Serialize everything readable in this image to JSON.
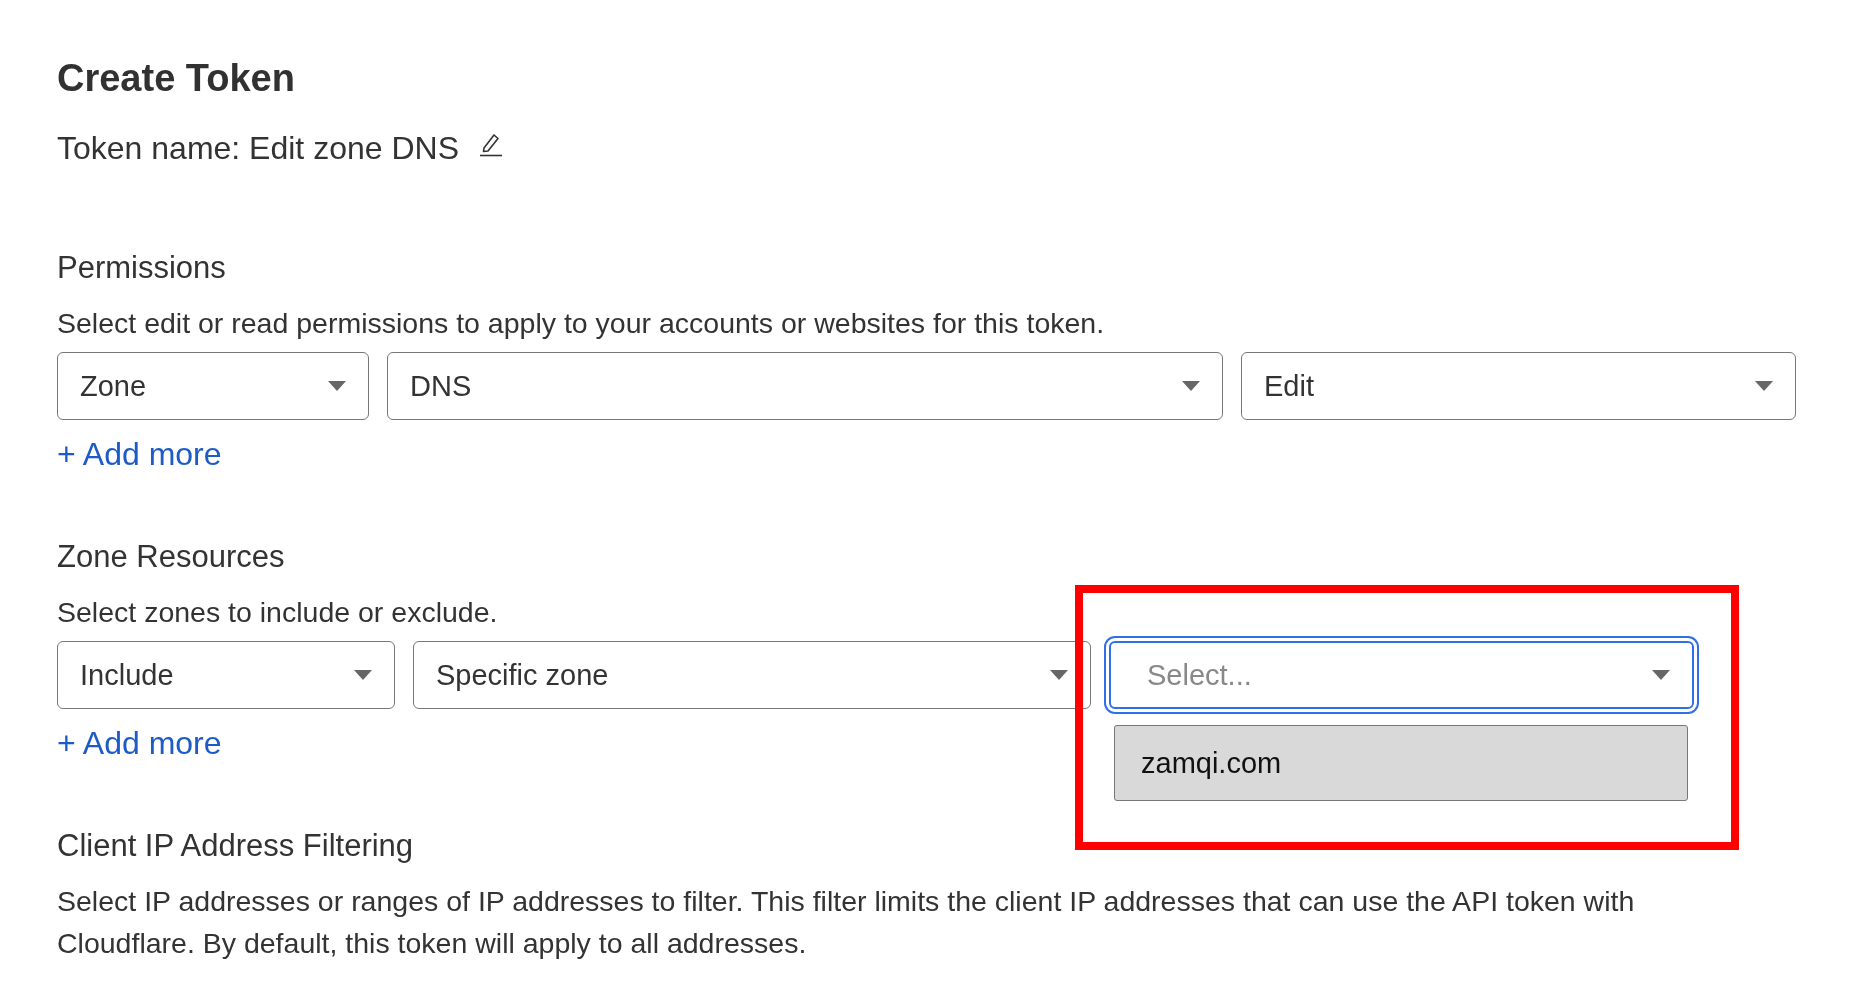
{
  "title": "Create Token",
  "token_name": {
    "text": "Token name: Edit zone DNS"
  },
  "sections": [
    {
      "heading": "Permissions",
      "description": "Select edit or read permissions to apply to your accounts or websites for this token.",
      "fields": [
        {
          "value": "Zone",
          "focused": false,
          "annotated": false
        },
        {
          "value": "DNS",
          "focused": false,
          "annotated": false
        },
        {
          "value": "Edit",
          "focused": false,
          "annotated": false
        }
      ],
      "add_link": "+ Add more"
    },
    {
      "heading": "Zone Resources",
      "description": "Select zones to include or exclude.",
      "fields": [
        {
          "value": "Include",
          "focused": false,
          "annotated": false
        },
        {
          "value": "Specific zone",
          "focused": false,
          "annotated": false
        },
        {
          "placeholder": "Select...",
          "focused": true,
          "annotated": true,
          "options": [
            {
              "label": "zamqi.com",
              "highlighted": true
            }
          ]
        }
      ],
      "add_link": "+ Add more"
    },
    {
      "heading": "Client IP Address Filtering",
      "description": "Select IP addresses or ranges of IP addresses to filter. This filter limits the client IP addresses that can use the API token with Cloudflare. By default, this token will apply to all addresses."
    }
  ]
}
